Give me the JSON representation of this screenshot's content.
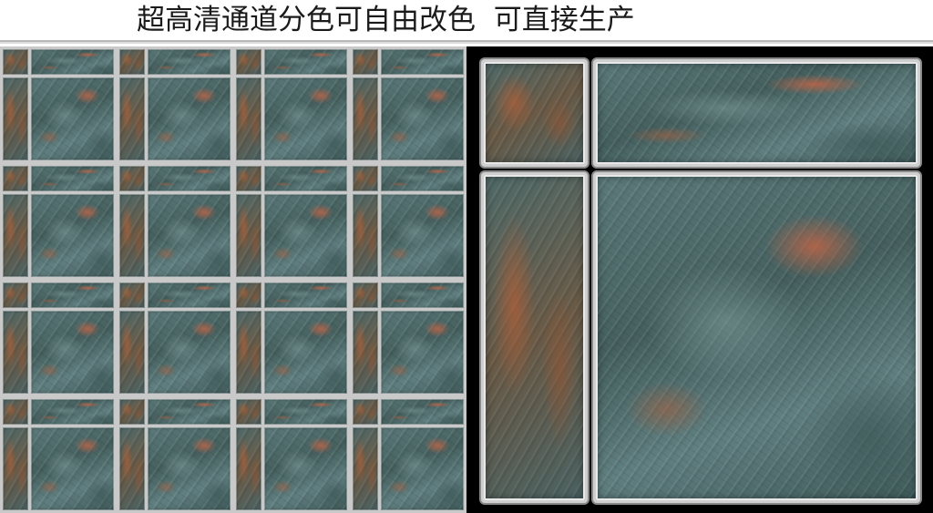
{
  "header": {
    "title": "超高清通道分色可自由改色  可直接生产"
  },
  "left_panel": {
    "description_name": "tiled-preview"
  },
  "right_panel": {
    "description_name": "tile-layout-detail"
  }
}
